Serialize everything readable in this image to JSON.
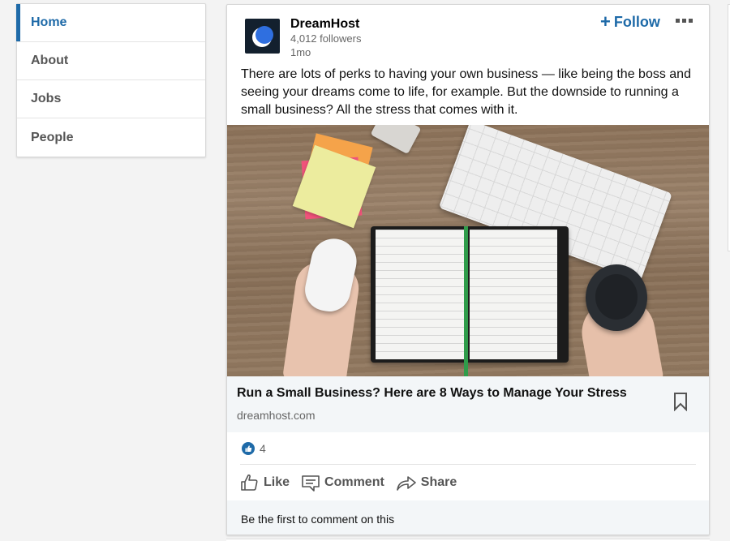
{
  "sidebar": {
    "items": [
      {
        "label": "Home",
        "active": true
      },
      {
        "label": "About",
        "active": false
      },
      {
        "label": "Jobs",
        "active": false
      },
      {
        "label": "People",
        "active": false
      }
    ]
  },
  "post": {
    "company": {
      "name": "DreamHost",
      "followers": "4,012 followers",
      "time": "1mo",
      "logo_icon": "dreamhost-moon-logo",
      "logo_bg": "#13202e",
      "logo_accent": "#2f6fe0"
    },
    "follow_label": "Follow",
    "follow_icon": "plus-icon",
    "more_icon": "ellipsis-icon",
    "text": "There are lots of perks to having your own business — like being the boss and seeing your dreams come to life, for example. But the downside to running a small business? All the stress that comes with it.",
    "image_alt": "Desk with notebook, keyboard, mouse, sticky notes and coffee cup",
    "link": {
      "title": "Run a Small Business? Here are 8 Ways to Manage Your Stress",
      "domain": "dreamhost.com",
      "save_icon": "bookmark-icon"
    },
    "reactions": {
      "count": "4",
      "icon": "like-reaction-icon"
    },
    "actions": [
      {
        "label": "Like",
        "icon": "thumbs-up-icon"
      },
      {
        "label": "Comment",
        "icon": "comment-icon"
      },
      {
        "label": "Share",
        "icon": "share-arrow-icon"
      }
    ],
    "comment_prompt": "Be the first to comment on this"
  },
  "colors": {
    "accent": "#1e6aa8",
    "background": "#f3f3f3",
    "preview_bg": "#f3f6f8"
  }
}
